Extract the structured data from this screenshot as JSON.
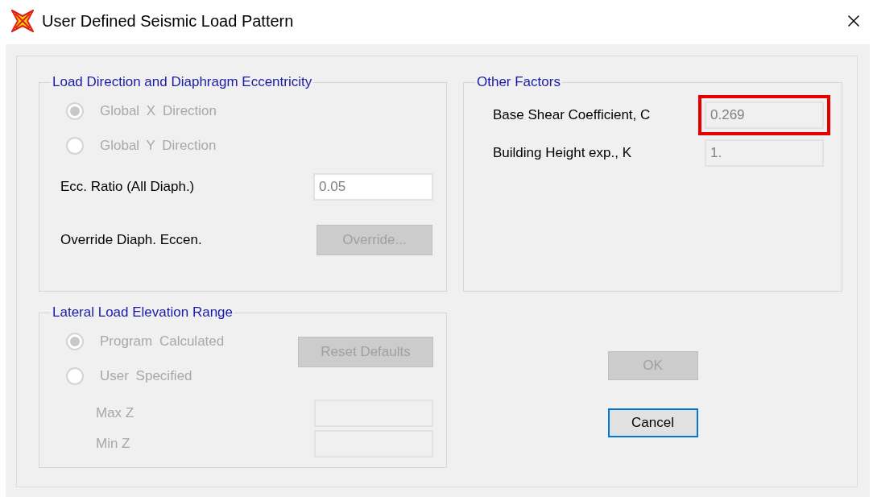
{
  "window": {
    "title": "User Defined Seismic Load Pattern"
  },
  "load_direction": {
    "title": "Load Direction and Diaphragm Eccentricity",
    "options": [
      {
        "label": "Global X Direction",
        "selected": true,
        "disabled": true
      },
      {
        "label": "Global Y Direction",
        "selected": false,
        "disabled": true
      }
    ],
    "ecc_ratio": {
      "label": "Ecc. Ratio (All Diaph.)",
      "value": "0.05",
      "disabled": false
    },
    "override": {
      "label": "Override Diaph. Eccen.",
      "button": "Override...",
      "disabled": true
    }
  },
  "elevation_range": {
    "title": "Lateral Load Elevation Range",
    "options": [
      {
        "label": "Program Calculated",
        "selected": true,
        "disabled": true
      },
      {
        "label": "User Specified",
        "selected": false,
        "disabled": true
      }
    ],
    "reset_button": {
      "label": "Reset Defaults",
      "disabled": true
    },
    "fields": [
      {
        "label": "Max Z",
        "disabled": true
      },
      {
        "label": "Min Z",
        "disabled": true
      }
    ]
  },
  "other_factors": {
    "title": "Other Factors",
    "fields": [
      {
        "label": "Base Shear Coefficient, C",
        "value": "0.269",
        "disabled": true,
        "highlighted": true
      },
      {
        "label": "Building Height exp., K",
        "value": "1.",
        "disabled": true,
        "highlighted": false
      }
    ]
  },
  "buttons": [
    {
      "label": "OK",
      "disabled": true,
      "focused": false
    },
    {
      "label": "Cancel",
      "disabled": false,
      "focused": true
    }
  ]
}
